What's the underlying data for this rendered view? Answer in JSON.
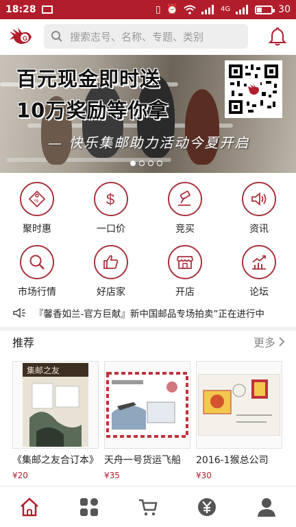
{
  "status_bar": {
    "time": "18:28",
    "network": "4G",
    "battery_level": "30",
    "battery_fraction": 0.3
  },
  "header": {
    "search_placeholder": "搜索志号、名称、专题、类别",
    "logo_icon": "logo-bird-icon",
    "notification_icon": "bell-icon"
  },
  "banner": {
    "line1": "百元现金即时送",
    "line2": "10万奖励等你拿",
    "slogan": "— 快乐集邮助力活动今夏开启",
    "page_count": 4,
    "active_index": 0
  },
  "menu": [
    {
      "label": "聚时惠",
      "icon": "price-tag-icon"
    },
    {
      "label": "一口价",
      "icon": "dollar-icon"
    },
    {
      "label": "竞买",
      "icon": "auction-hammer-icon"
    },
    {
      "label": "资讯",
      "icon": "speaker-icon"
    },
    {
      "label": "市场行情",
      "icon": "magnifier-icon"
    },
    {
      "label": "好店家",
      "icon": "thumbs-up-icon"
    },
    {
      "label": "开店",
      "icon": "storefront-icon"
    },
    {
      "label": "论坛",
      "icon": "trend-chart-icon"
    }
  ],
  "notice": {
    "text": "『馨香如兰-官方巨献』新中国邮品专场拍卖”正在进行中"
  },
  "recommend": {
    "title": "推荐",
    "more": "更多",
    "items": [
      {
        "title": "《集邮之友合订本》",
        "price": "¥20",
        "image_text": "集邮之友"
      },
      {
        "title": "天舟一号货运飞船",
        "price": "¥35",
        "image_text": ""
      },
      {
        "title": "2016-1猴总公司",
        "price": "¥30",
        "image_text": ""
      }
    ]
  },
  "tabs": [
    {
      "name": "home",
      "icon": "home-icon",
      "active": true
    },
    {
      "name": "category",
      "icon": "grid-icon",
      "active": false
    },
    {
      "name": "cart",
      "icon": "cart-icon",
      "active": false
    },
    {
      "name": "wallet",
      "icon": "yuan-icon",
      "active": false
    },
    {
      "name": "profile",
      "icon": "user-icon",
      "active": false
    }
  ],
  "colors": {
    "brand": "#b21d2b",
    "icon_ring": "#a8323c",
    "price": "#b21d2b"
  }
}
